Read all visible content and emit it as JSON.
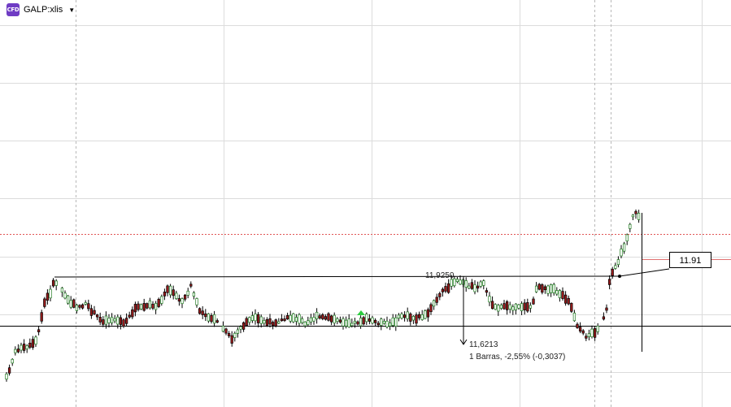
{
  "instrument": {
    "badge": "CFD",
    "symbol": "GALP:xlis",
    "dropdown_icon": "caret-down-icon"
  },
  "price_tag": "11.91",
  "measure_tool": {
    "start_label": "11,9250",
    "end_label": "11,6213",
    "summary": "1 Barras, -2,55% (-0,3037)"
  },
  "colors": {
    "up_candle": "#ffffff",
    "down_candle": "#9b1c1c",
    "grid": "#d9d9d9",
    "current_price_line": "#e05555",
    "signal_marker": "#2ecc40"
  }
}
